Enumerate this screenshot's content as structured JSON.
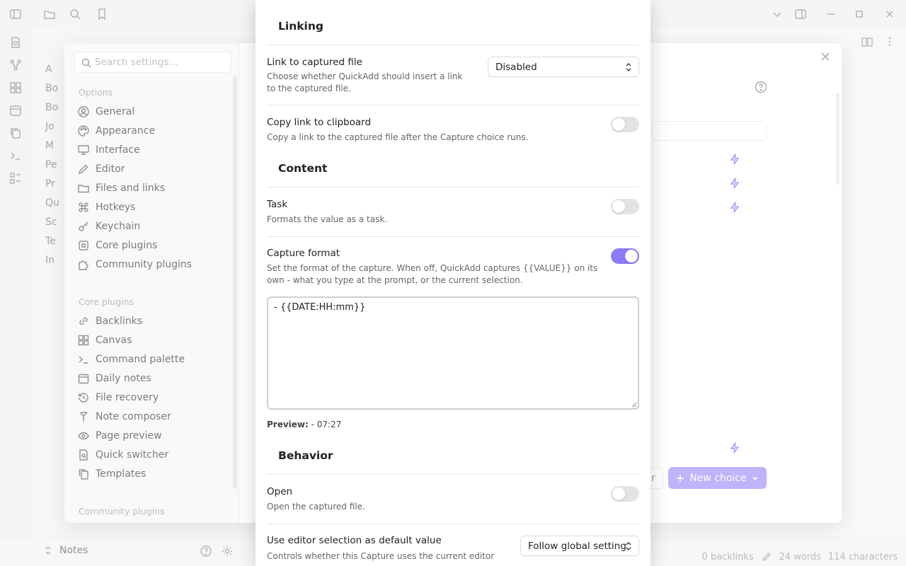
{
  "background": {
    "file_tree": [
      "A",
      "Bo",
      "Bo",
      "Jo",
      "M",
      "Pe",
      "Pr",
      "Qu",
      "Sc",
      "Te",
      "In"
    ],
    "vault_name": "Notes",
    "status": {
      "backlinks": "0 backlinks",
      "words": "24 words",
      "characters": "114 characters"
    }
  },
  "settings": {
    "search_placeholder": "Search settings...",
    "options_heading": "Options",
    "options": [
      {
        "label": "General",
        "icon": "user-circle-icon"
      },
      {
        "label": "Appearance",
        "icon": "palette-icon"
      },
      {
        "label": "Interface",
        "icon": "monitor-icon"
      },
      {
        "label": "Editor",
        "icon": "pencil-icon"
      },
      {
        "label": "Files and links",
        "icon": "folder-icon"
      },
      {
        "label": "Hotkeys",
        "icon": "command-icon"
      },
      {
        "label": "Keychain",
        "icon": "key-icon"
      },
      {
        "label": "Core plugins",
        "icon": "plug-icon"
      },
      {
        "label": "Community plugins",
        "icon": "puzzle-icon"
      }
    ],
    "core_heading": "Core plugins",
    "core_plugins": [
      {
        "label": "Backlinks",
        "icon": "link-icon"
      },
      {
        "label": "Canvas",
        "icon": "grid-icon"
      },
      {
        "label": "Command palette",
        "icon": "terminal-icon"
      },
      {
        "label": "Daily notes",
        "icon": "calendar-icon"
      },
      {
        "label": "File recovery",
        "icon": "history-icon"
      },
      {
        "label": "Note composer",
        "icon": "merge-icon"
      },
      {
        "label": "Page preview",
        "icon": "eye-icon"
      },
      {
        "label": "Quick switcher",
        "icon": "file-search-icon"
      },
      {
        "label": "Templates",
        "icon": "copy-icon"
      }
    ],
    "community_heading": "Community plugins",
    "new_choice_label": "New choice",
    "ghost_button_label": "r"
  },
  "capture": {
    "linking": {
      "heading": "Linking",
      "link_to_file": {
        "title": "Link to captured file",
        "desc": "Choose whether QuickAdd should insert a link to the captured file.",
        "value": "Disabled"
      },
      "copy_link": {
        "title": "Copy link to clipboard",
        "desc": "Copy a link to the captured file after the Capture choice runs.",
        "enabled": false
      }
    },
    "content": {
      "heading": "Content",
      "task": {
        "title": "Task",
        "desc": "Formats the value as a task.",
        "enabled": false
      },
      "capture_format": {
        "title": "Capture format",
        "desc": "Set the format of the capture. When off, QuickAdd captures {{VALUE}} on its own - what you type at the prompt, or the current selection.",
        "enabled": true,
        "value": "- {{DATE:HH:mm}}",
        "preview_label": "Preview:",
        "preview_value": "- 07:27"
      }
    },
    "behavior": {
      "heading": "Behavior",
      "open": {
        "title": "Open",
        "desc": "Open the captured file.",
        "enabled": false
      },
      "editor_selection": {
        "title": "Use editor selection as default value",
        "desc": "Controls whether this Capture uses the current editor",
        "value": "Follow global setting"
      }
    }
  },
  "colors": {
    "accent": "#8b7cf6",
    "accent_button": "#9a8cf7"
  }
}
